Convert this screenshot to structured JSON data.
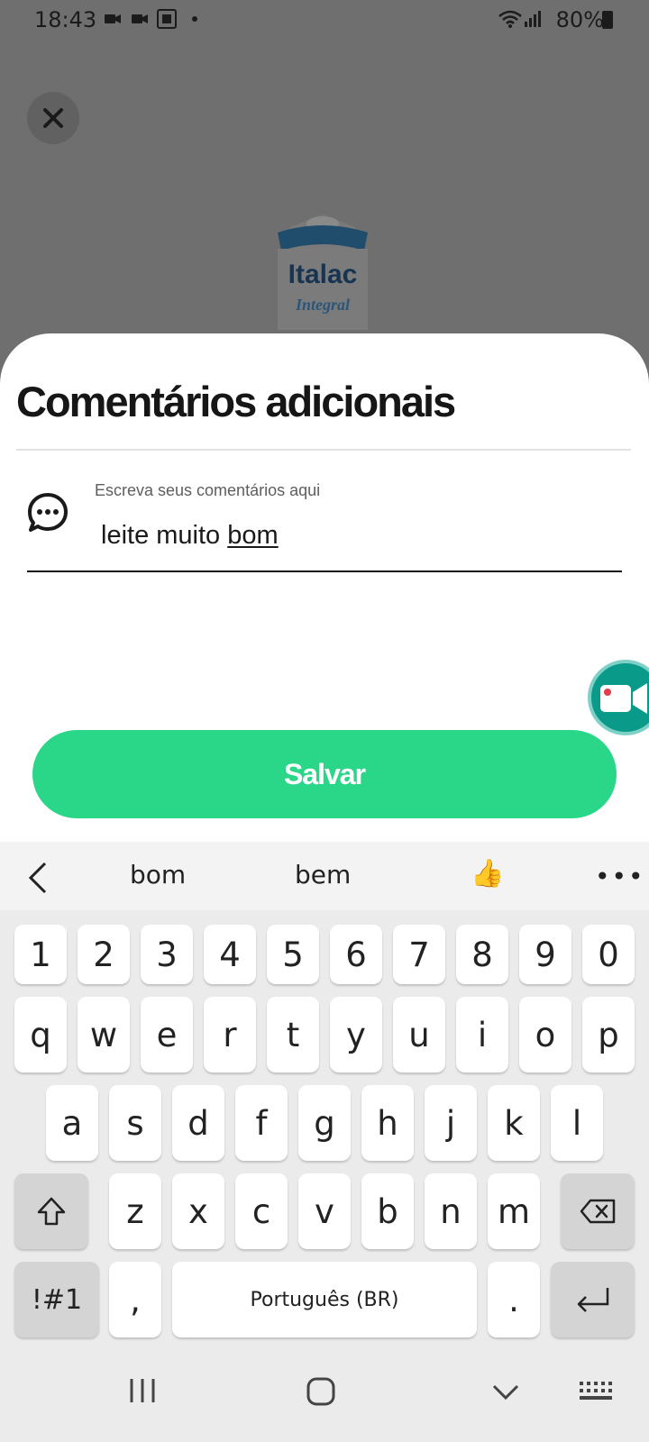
{
  "status_bar": {
    "time": "18:43",
    "battery": "80%"
  },
  "product": {
    "brand": "Italac",
    "variant": "Integral"
  },
  "sheet": {
    "title": "Comentários adicionais",
    "field_label": "Escreva seus comentários aqui",
    "field_value_prefix": "leite muito ",
    "field_value_word": "bom",
    "save_label": "Salvar"
  },
  "keyboard": {
    "suggestions": [
      "bom",
      "bem"
    ],
    "emoji": "👍",
    "more": "•••",
    "row_numbers": [
      "1",
      "2",
      "3",
      "4",
      "5",
      "6",
      "7",
      "8",
      "9",
      "0"
    ],
    "row_q": [
      "q",
      "w",
      "e",
      "r",
      "t",
      "y",
      "u",
      "i",
      "o",
      "p"
    ],
    "row_a": [
      "a",
      "s",
      "d",
      "f",
      "g",
      "h",
      "j",
      "k",
      "l"
    ],
    "row_z": [
      "z",
      "x",
      "c",
      "v",
      "b",
      "n",
      "m"
    ],
    "symbols_label": "!#1",
    "comma": ",",
    "space_label": "Português (BR)",
    "period": "."
  },
  "colors": {
    "accent": "#2ad688",
    "record": "#0a9a8a"
  },
  "icons": [
    "close-icon",
    "comment-bubble-icon",
    "video-camera-icon",
    "shift-icon",
    "backspace-icon",
    "enter-icon"
  ]
}
